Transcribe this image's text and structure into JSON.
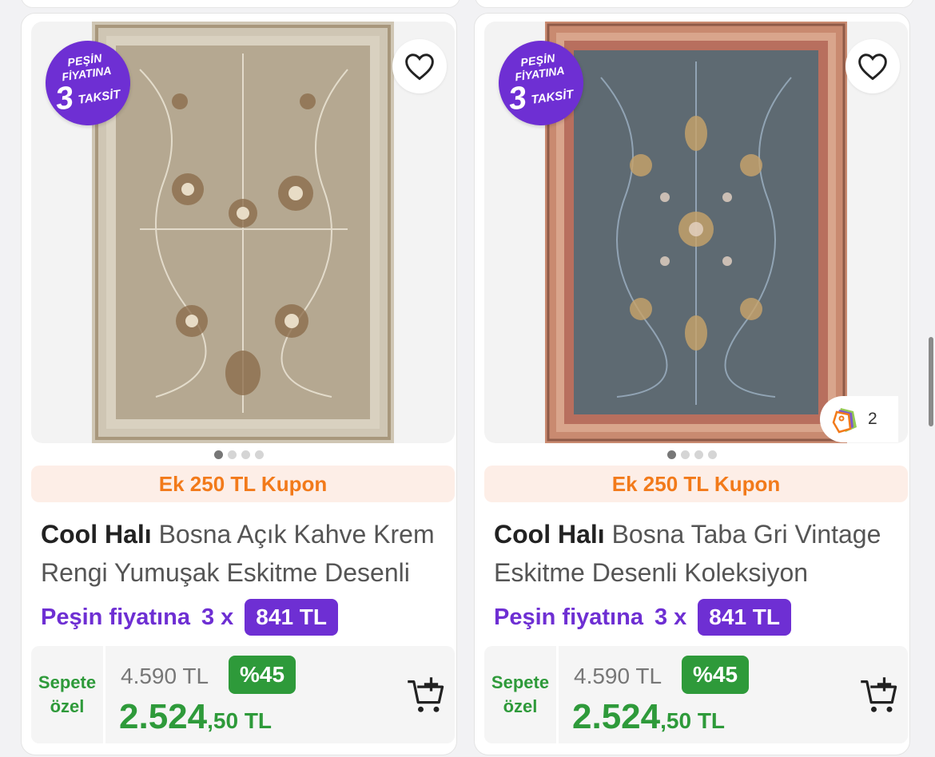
{
  "products": [
    {
      "badge": {
        "line1": "PEŞİN",
        "line2": "FİYATINA",
        "number": "3",
        "word": "TAKSİT"
      },
      "coupon": "Ek 250 TL Kupon",
      "brand": "Cool Halı",
      "name": "Bosna Açık Kahve Krem Rengi Yumuşak Eskitme Desenli",
      "installment_label": "Peşin fiyatına",
      "installment_mult": "3 x",
      "installment_amount": "841 TL",
      "basket_label_1": "Sepete",
      "basket_label_2": "özel",
      "old_price": "4.590 TL",
      "discount": "%45",
      "price_main": "2.524",
      "price_dec": ",50 TL",
      "rug_colors": {
        "field": "#b5a891",
        "border": "#cfc6b4",
        "accent": "#8a6a48"
      },
      "icons": {
        "favorite": "heart-icon",
        "cart": "add-to-cart-icon"
      }
    },
    {
      "badge": {
        "line1": "PEŞİN",
        "line2": "FİYATINA",
        "number": "3",
        "word": "TAKSİT"
      },
      "coupon": "Ek 250 TL Kupon",
      "brand": "Cool Halı",
      "name": "Bosna Taba Gri Vintage Eskitme Desenli Koleksiyon",
      "installment_label": "Peşin fiyatına",
      "installment_mult": "3 x",
      "installment_amount": "841 TL",
      "basket_label_1": "Sepete",
      "basket_label_2": "özel",
      "old_price": "4.590 TL",
      "discount": "%45",
      "price_main": "2.524",
      "price_dec": ",50 TL",
      "collection_count": "2",
      "rug_colors": {
        "field": "#5e6a72",
        "border": "#c98a70",
        "accent": "#9aaec0"
      },
      "icons": {
        "favorite": "heart-icon",
        "cart": "add-to-cart-icon",
        "collection": "price-tags-icon"
      }
    }
  ],
  "theme": {
    "purple": "#6e2fd3",
    "orange": "#f27a1a",
    "green": "#2e9a3a"
  }
}
